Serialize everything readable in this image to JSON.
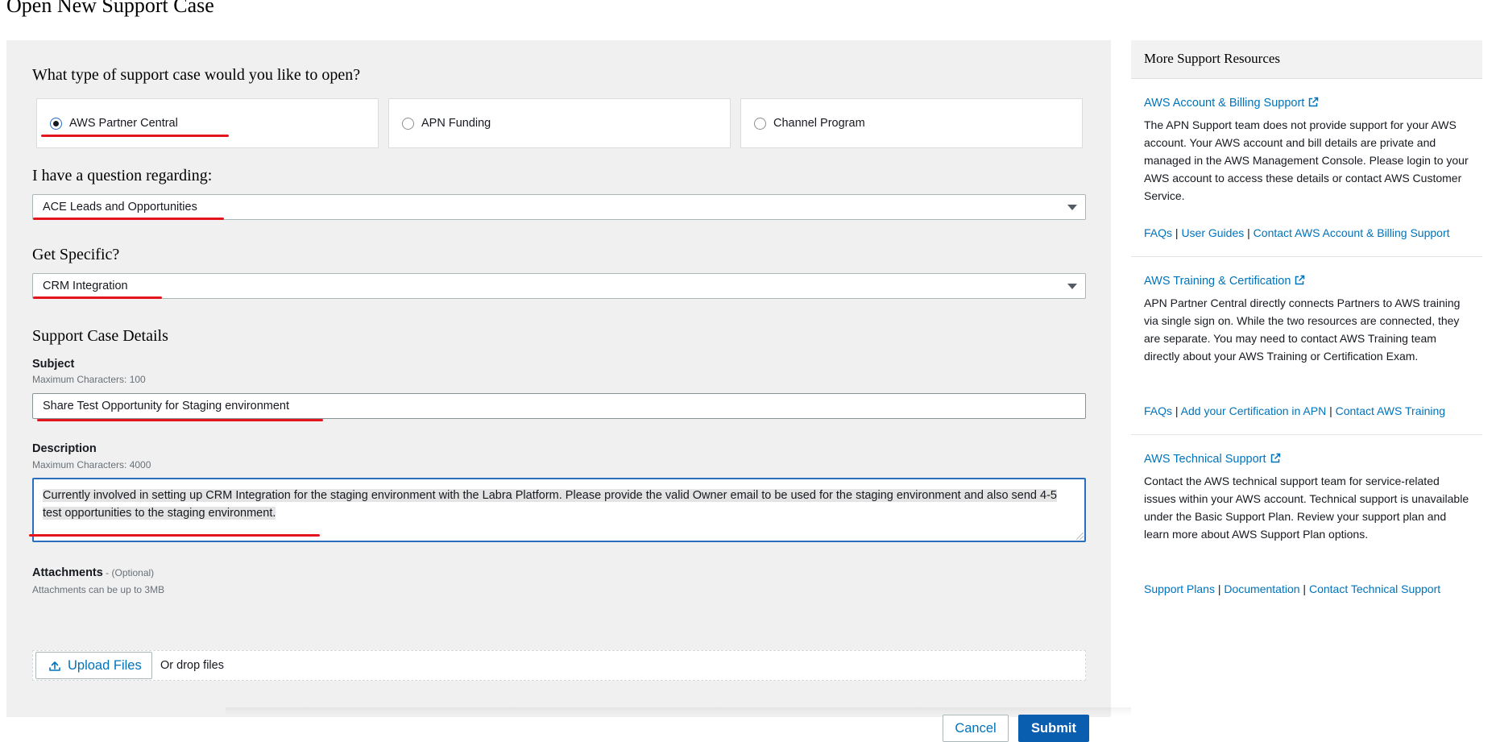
{
  "page": {
    "title": "Open New Support Case"
  },
  "case_type": {
    "heading": "What type of support case would you like to open?",
    "options": [
      {
        "label": "AWS Partner Central",
        "selected": true
      },
      {
        "label": "APN Funding",
        "selected": false
      },
      {
        "label": "Channel Program",
        "selected": false
      }
    ]
  },
  "question": {
    "heading": "I have a question regarding:",
    "value": "ACE Leads and Opportunities"
  },
  "specific": {
    "heading": "Get Specific?",
    "value": "CRM Integration"
  },
  "details": {
    "heading": "Support Case Details",
    "subject": {
      "label": "Subject",
      "hint": "Maximum Characters: 100",
      "value": "Share Test Opportunity for Staging  environment"
    },
    "description": {
      "label": "Description",
      "hint": "Maximum Characters: 4000",
      "value": "Currently involved in setting up CRM Integration for the staging environment with the Labra Platform. Please provide the valid Owner email to be used for the staging environment and also send 4-5 test opportunities to the staging environment."
    },
    "attachments": {
      "label": "Attachments",
      "optional": " - (Optional)",
      "hint": "Attachments can be up to 3MB",
      "upload_label": "Upload Files",
      "drop_text": "Or drop files"
    }
  },
  "actions": {
    "cancel": "Cancel",
    "submit": "Submit"
  },
  "sidebar": {
    "title": "More Support Resources",
    "resources": [
      {
        "title": "AWS Account & Billing Support",
        "body": "The APN Support team does not provide support for your AWS account. Your AWS account and bill details are private and managed in the AWS Management Console. Please login to your AWS account to access these details or contact AWS Customer Service.",
        "links": [
          "FAQs",
          "User Guides",
          "Contact AWS Account & Billing Support"
        ]
      },
      {
        "title": "AWS Training & Certification",
        "body": "APN Partner Central directly connects Partners to AWS training via single sign on. While the two resources are connected, they are separate. You may need to contact AWS Training team directly about your AWS Training or Certification Exam.",
        "links": [
          "FAQs",
          "Add your Certification in APN",
          "Contact AWS Training"
        ]
      },
      {
        "title": "AWS Technical Support",
        "body": "Contact the AWS technical support team for service-related issues within your AWS account. Technical support is unavailable under the Basic Support Plan. Review your support plan and learn more about AWS Support Plan options.",
        "links": [
          "Support Plans",
          "Documentation",
          "Contact Technical Support"
        ]
      }
    ],
    "link_separator": " | "
  },
  "colors": {
    "accent": "#0073bb",
    "primary_button": "#0a5eb0",
    "annotation": "#e3141b"
  }
}
